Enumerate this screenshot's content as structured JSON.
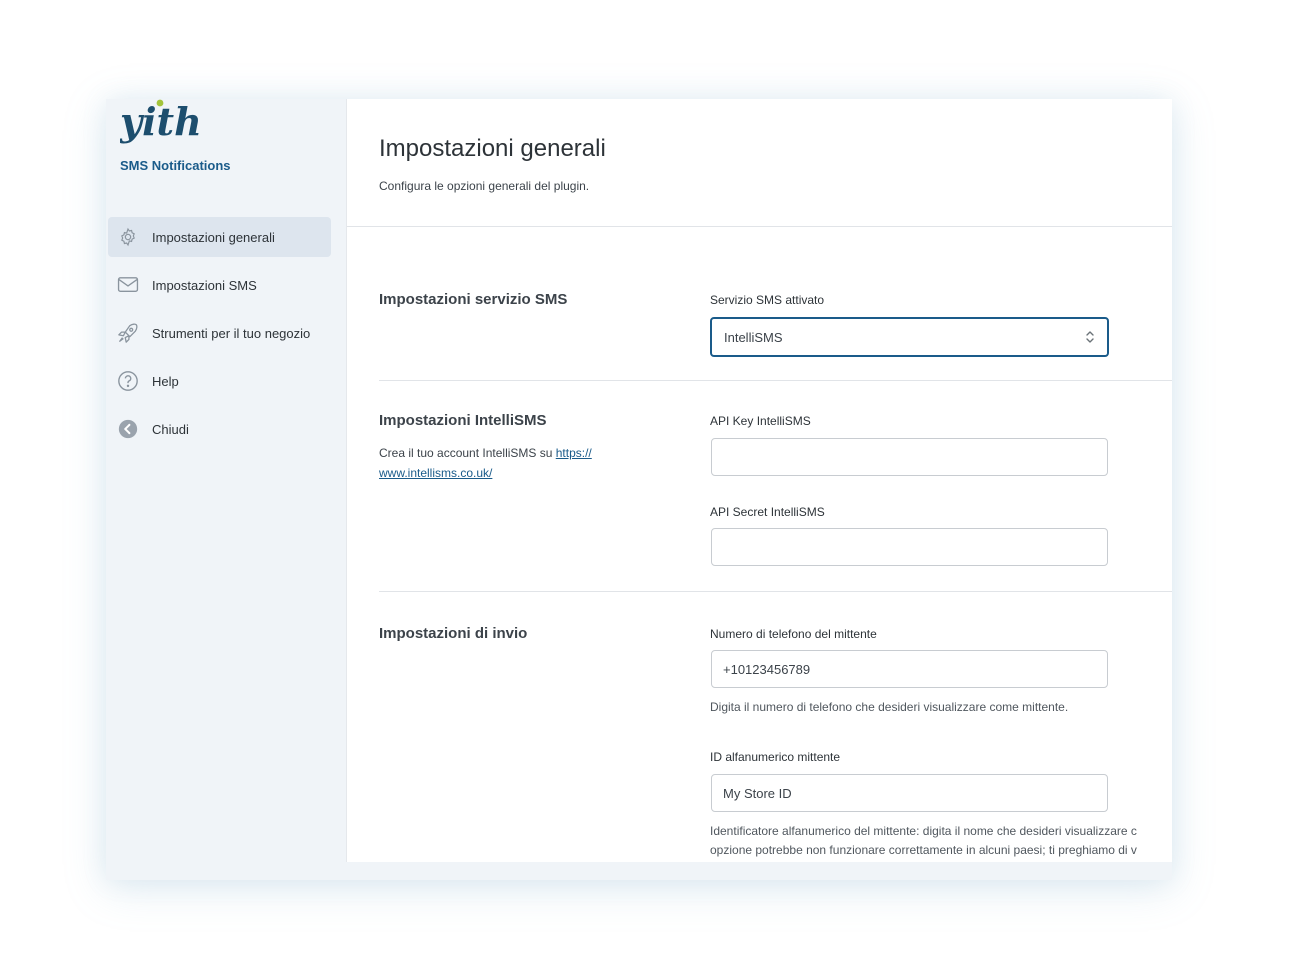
{
  "brand": {
    "logo_text": "yith",
    "subtitle": "SMS Notifications"
  },
  "sidebar": {
    "items": [
      {
        "label": "Impostazioni generali",
        "icon": "gear-icon",
        "active": true
      },
      {
        "label": "Impostazioni SMS",
        "icon": "envelope-icon"
      },
      {
        "label": "Strumenti per il tuo negozio",
        "icon": "rocket-icon"
      },
      {
        "label": "Help",
        "icon": "question-circle-icon"
      },
      {
        "label": "Chiudi",
        "icon": "arrow-left-circle-icon"
      }
    ]
  },
  "header": {
    "title": "Impostazioni generali",
    "description": "Configura le opzioni generali del plugin."
  },
  "sections": {
    "sms_service": {
      "title": "Impostazioni servizio SMS",
      "field_label": "Servizio SMS attivato",
      "selected": "IntelliSMS"
    },
    "intellisms": {
      "title": "Impostazioni IntelliSMS",
      "desc_prefix": "Crea il tuo account IntelliSMS su ",
      "link_line1": "https://",
      "link_line2": "www.intellisms.co.uk/",
      "api_key_label": "API Key IntelliSMS",
      "api_key_value": "",
      "api_secret_label": "API Secret IntelliSMS",
      "api_secret_value": ""
    },
    "sending": {
      "title": "Impostazioni di invio",
      "phone_label": "Numero di telefono del mittente",
      "phone_value": "+10123456789",
      "phone_help": "Digita il numero di telefono che desideri visualizzare come mittente.",
      "alpha_label": "ID alfanumerico mittente",
      "alpha_value": "My Store ID",
      "alpha_help_line1": "Identificatore alfanumerico del mittente: digita il nome che desideri visualizzare c",
      "alpha_help_line2": "opzione potrebbe non funzionare correttamente in alcuni paesi; ti preghiamo di v"
    }
  },
  "colors": {
    "accent": "#1a5b8a",
    "logo": "#1d4e6e",
    "logo_dot": "#a3c43b"
  }
}
